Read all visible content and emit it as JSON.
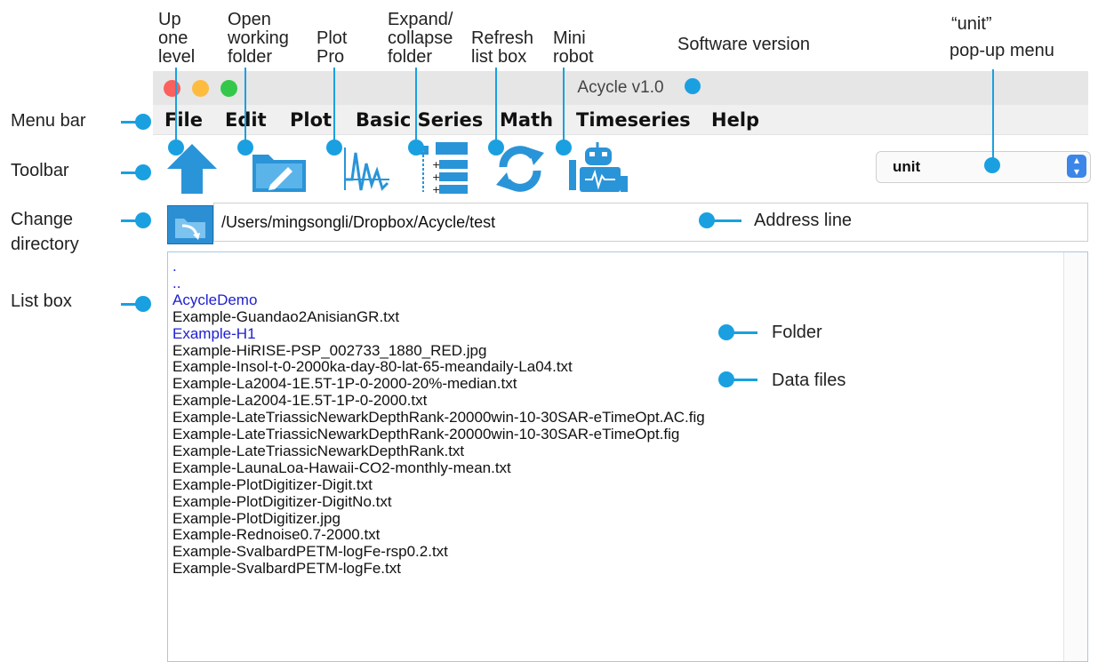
{
  "window": {
    "title": "Acycle v1.0"
  },
  "menu": [
    "File",
    "Edit",
    "Plot",
    "Basic Series",
    "Math",
    "Timeseries",
    "Help"
  ],
  "toolbar": {
    "buttons": [
      {
        "icon": "up-arrow-icon",
        "name": "up-one-level"
      },
      {
        "icon": "folder-edit-icon",
        "name": "open-working-folder"
      },
      {
        "icon": "plot-wave-icon",
        "name": "plot-pro"
      },
      {
        "icon": "tree-expand-icon",
        "name": "expand-collapse-folder"
      },
      {
        "icon": "refresh-icon",
        "name": "refresh-list-box"
      },
      {
        "icon": "robot-icon",
        "name": "mini-robot"
      }
    ],
    "unit_value": "unit"
  },
  "address": {
    "path": "/Users/mingsongli/Dropbox/Acycle/test"
  },
  "listbox": {
    "items": [
      {
        "text": ".",
        "type": "folder"
      },
      {
        "text": "..",
        "type": "folder"
      },
      {
        "text": "AcycleDemo",
        "type": "folder"
      },
      {
        "text": "Example-Guandao2AnisianGR.txt",
        "type": "file"
      },
      {
        "text": "Example-H1",
        "type": "folder"
      },
      {
        "text": "Example-HiRISE-PSP_002733_1880_RED.jpg",
        "type": "file"
      },
      {
        "text": "Example-Insol-t-0-2000ka-day-80-lat-65-meandaily-La04.txt",
        "type": "file"
      },
      {
        "text": "Example-La2004-1E.5T-1P-0-2000-20%-median.txt",
        "type": "file"
      },
      {
        "text": "Example-La2004-1E.5T-1P-0-2000.txt",
        "type": "file"
      },
      {
        "text": "Example-LateTriassicNewarkDepthRank-20000win-10-30SAR-eTimeOpt.AC.fig",
        "type": "file"
      },
      {
        "text": "Example-LateTriassicNewarkDepthRank-20000win-10-30SAR-eTimeOpt.fig",
        "type": "file"
      },
      {
        "text": "Example-LateTriassicNewarkDepthRank.txt",
        "type": "file"
      },
      {
        "text": "Example-LaunaLoa-Hawaii-CO2-monthly-mean.txt",
        "type": "file"
      },
      {
        "text": "Example-PlotDigitizer-Digit.txt",
        "type": "file"
      },
      {
        "text": "Example-PlotDigitizer-DigitNo.txt",
        "type": "file"
      },
      {
        "text": "Example-PlotDigitizer.jpg",
        "type": "file"
      },
      {
        "text": "Example-Rednoise0.7-2000.txt",
        "type": "file"
      },
      {
        "text": "Example-SvalbardPETM-logFe-rsp0.2.txt",
        "type": "file"
      },
      {
        "text": "Example-SvalbardPETM-logFe.txt",
        "type": "file"
      }
    ]
  },
  "annotations": {
    "up_one_level": [
      "Up",
      "one",
      "level"
    ],
    "open_working_folder": [
      "Open",
      "working",
      "folder"
    ],
    "plot_pro": [
      "Plot",
      "Pro"
    ],
    "expand_collapse": [
      "Expand/",
      "collapse",
      "folder"
    ],
    "refresh": [
      "Refresh",
      "list box"
    ],
    "mini_robot": [
      "Mini",
      "robot"
    ],
    "software_version": "Software version",
    "unit_menu": [
      "“unit”",
      "pop-up menu"
    ],
    "menu_bar": "Menu bar",
    "toolbar": "Toolbar",
    "change_directory": [
      "Change",
      "directory"
    ],
    "list_box": "List box",
    "address_line": "Address line",
    "folder": "Folder",
    "data_files": "Data files"
  },
  "colors": {
    "accent": "#1aa0e0",
    "folder_text": "#2020d0",
    "file_text": "#111111",
    "icon_blue": "#2a94d8"
  }
}
